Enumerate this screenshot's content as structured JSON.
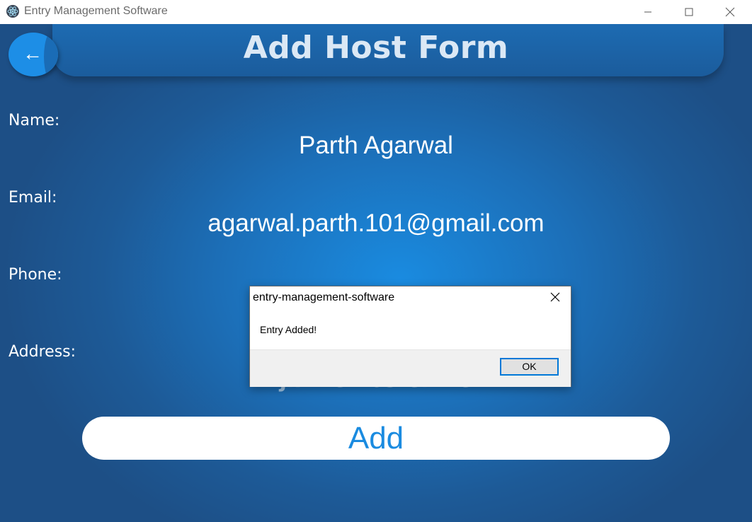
{
  "window": {
    "title": "Entry Management Software",
    "icon": "electron-icon"
  },
  "header": {
    "back_label": "←",
    "title": "Add Host Form"
  },
  "form": {
    "name_label": "Name:",
    "name_value": "Parth Agarwal",
    "email_label": "Email:",
    "email_value": "agarwal.parth.101@gmail.com",
    "phone_label": "Phone:",
    "phone_value": "",
    "address_label": "Address:",
    "address_value_partial": "jlit ke hostel me",
    "add_label": "Add"
  },
  "dialog": {
    "title": "entry-management-software",
    "message": "Entry Added!",
    "ok_label": "OK"
  },
  "colors": {
    "accent": "#1a8be0",
    "background_center": "#1a8be0",
    "background_edge": "#1d4f86"
  }
}
